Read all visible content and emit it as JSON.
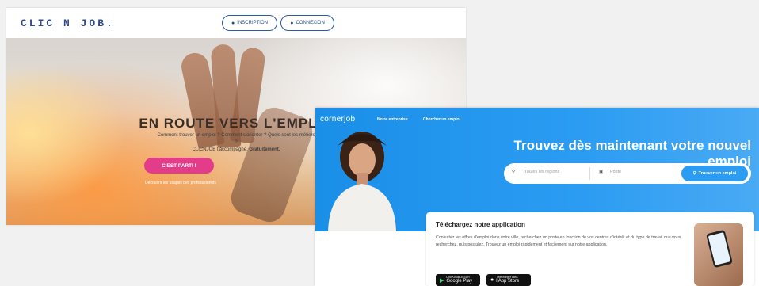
{
  "clicnjob": {
    "logo": "CLIC N JOB.",
    "nav": {
      "inscription_label": "INSCRIPTION",
      "connexion_label": "CONNEXION"
    },
    "hero": {
      "title": "EN ROUTE VERS L'EMPLOI",
      "subtitle_line1": "Comment trouver un emploi ? Comment s'orienter ? Quels sont les métiers ?",
      "subtitle_line2_prefix": "CLICNJOB t'accompagne.",
      "subtitle_line2_bold": "Gratuitement.",
      "cta_label": "C'EST PARTI !",
      "link_label": "Découvrir les usages des professionnels"
    },
    "colors": {
      "accent": "#e33d8a",
      "brand": "#2d4a8a"
    }
  },
  "cornerjob": {
    "logo": "cornerjob",
    "nav": {
      "employer_label": "Notre entreprise",
      "search_label": "Chercher un emploi"
    },
    "hero": {
      "headline": "Trouvez dès maintenant votre nouvel emploi",
      "region_placeholder": "Toutes les régions",
      "job_placeholder": "Poste",
      "search_button_label": "Trouver un emploi"
    },
    "app": {
      "title": "Téléchargez notre application",
      "description": "Consultez les offres d'emploi dans votre ville, recherchez un poste en fonction de vos centres d'intérêt et du type de travail que vous recherchez, puis postulez. Trouvez un emploi rapidement et facilement sur notre application.",
      "google_play_small": "DISPONIBLE SUR",
      "google_play_label": "Google Play",
      "app_store_small": "Télécharger dans",
      "app_store_label": "l'App Store"
    },
    "colors": {
      "primary": "#2b9cf2"
    }
  },
  "icons": [
    "user-icon",
    "lock-icon",
    "location-pin-icon",
    "briefcase-icon",
    "search-icon",
    "play-icon",
    "apple-icon"
  ]
}
